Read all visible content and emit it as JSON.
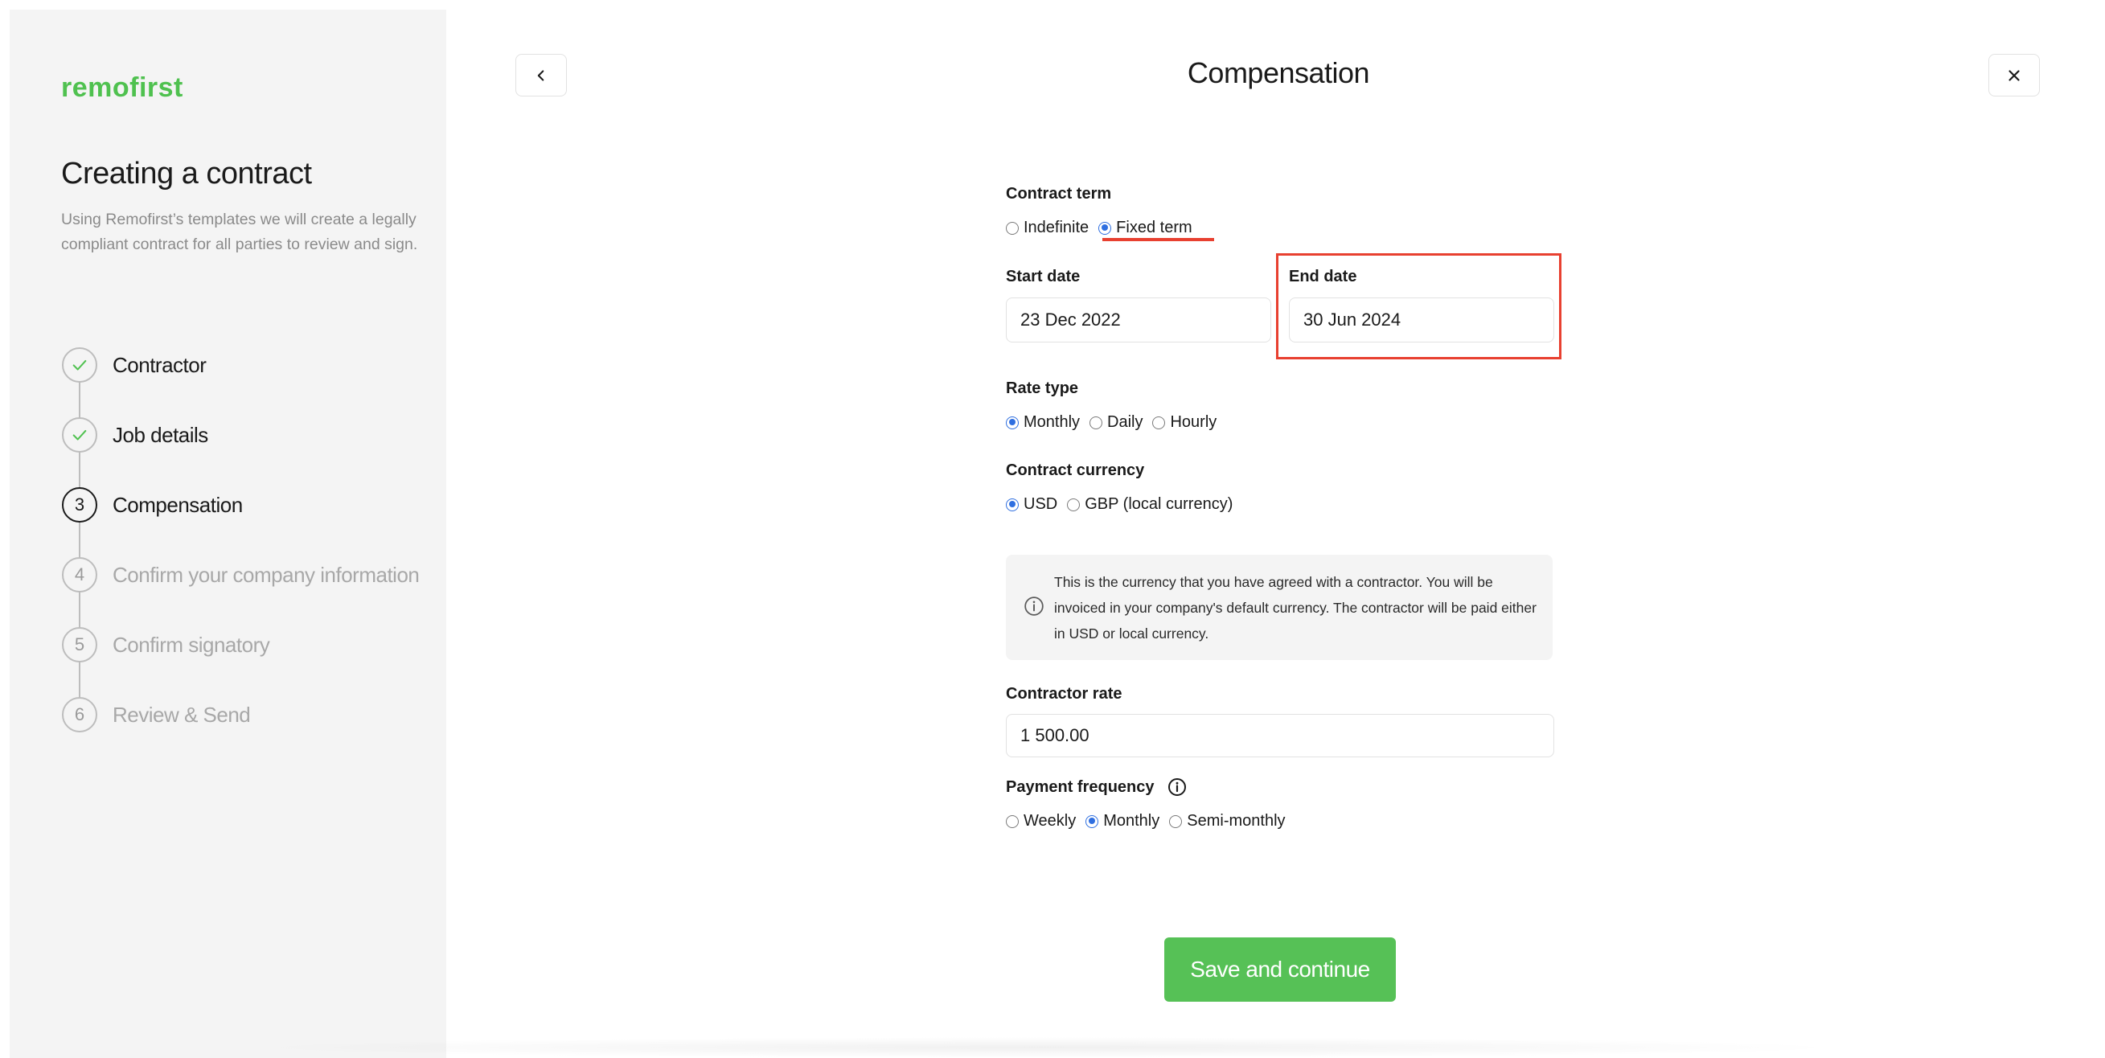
{
  "sidebar": {
    "logo": "remofirst",
    "title": "Creating a contract",
    "description": "Using Remofirst’s templates we will create a legally compliant contract for all parties to review and sign.",
    "steps": [
      {
        "number": "1",
        "label": "Contractor",
        "status": "done"
      },
      {
        "number": "2",
        "label": "Job details",
        "status": "done"
      },
      {
        "number": "3",
        "label": "Compensation",
        "status": "current"
      },
      {
        "number": "4",
        "label": "Confirm your company information",
        "status": "upcoming"
      },
      {
        "number": "5",
        "label": "Confirm signatory",
        "status": "upcoming"
      },
      {
        "number": "6",
        "label": "Review & Send",
        "status": "upcoming"
      }
    ]
  },
  "header": {
    "title": "Compensation",
    "back_icon": "chevron-left-icon",
    "close_icon": "close-icon"
  },
  "form": {
    "contract_term": {
      "label": "Contract term",
      "options": [
        "Indefinite",
        "Fixed term"
      ],
      "selected": "Fixed term"
    },
    "start_date": {
      "label": "Start date",
      "value": "23 Dec 2022"
    },
    "end_date": {
      "label": "End date",
      "value": "30 Jun 2024"
    },
    "rate_type": {
      "label": "Rate type",
      "options": [
        "Monthly",
        "Daily",
        "Hourly"
      ],
      "selected": "Monthly"
    },
    "contract_currency": {
      "label": "Contract currency",
      "options": [
        "USD",
        "GBP (local currency)"
      ],
      "selected": "USD"
    },
    "currency_info": "This is the currency that you have agreed with a contractor. You will be invoiced in your company's default currency. The contractor will be paid either in USD or local currency.",
    "contractor_rate": {
      "label": "Contractor rate",
      "value": "1 500.00"
    },
    "payment_frequency": {
      "label": "Payment frequency",
      "options": [
        "Weekly",
        "Monthly",
        "Semi-monthly"
      ],
      "selected": "Monthly"
    }
  },
  "actions": {
    "save_label": "Save and continue"
  },
  "colors": {
    "brand_green": "#4fc14f",
    "radio_blue": "#2f6fe0",
    "annotation_red": "#e84030"
  }
}
